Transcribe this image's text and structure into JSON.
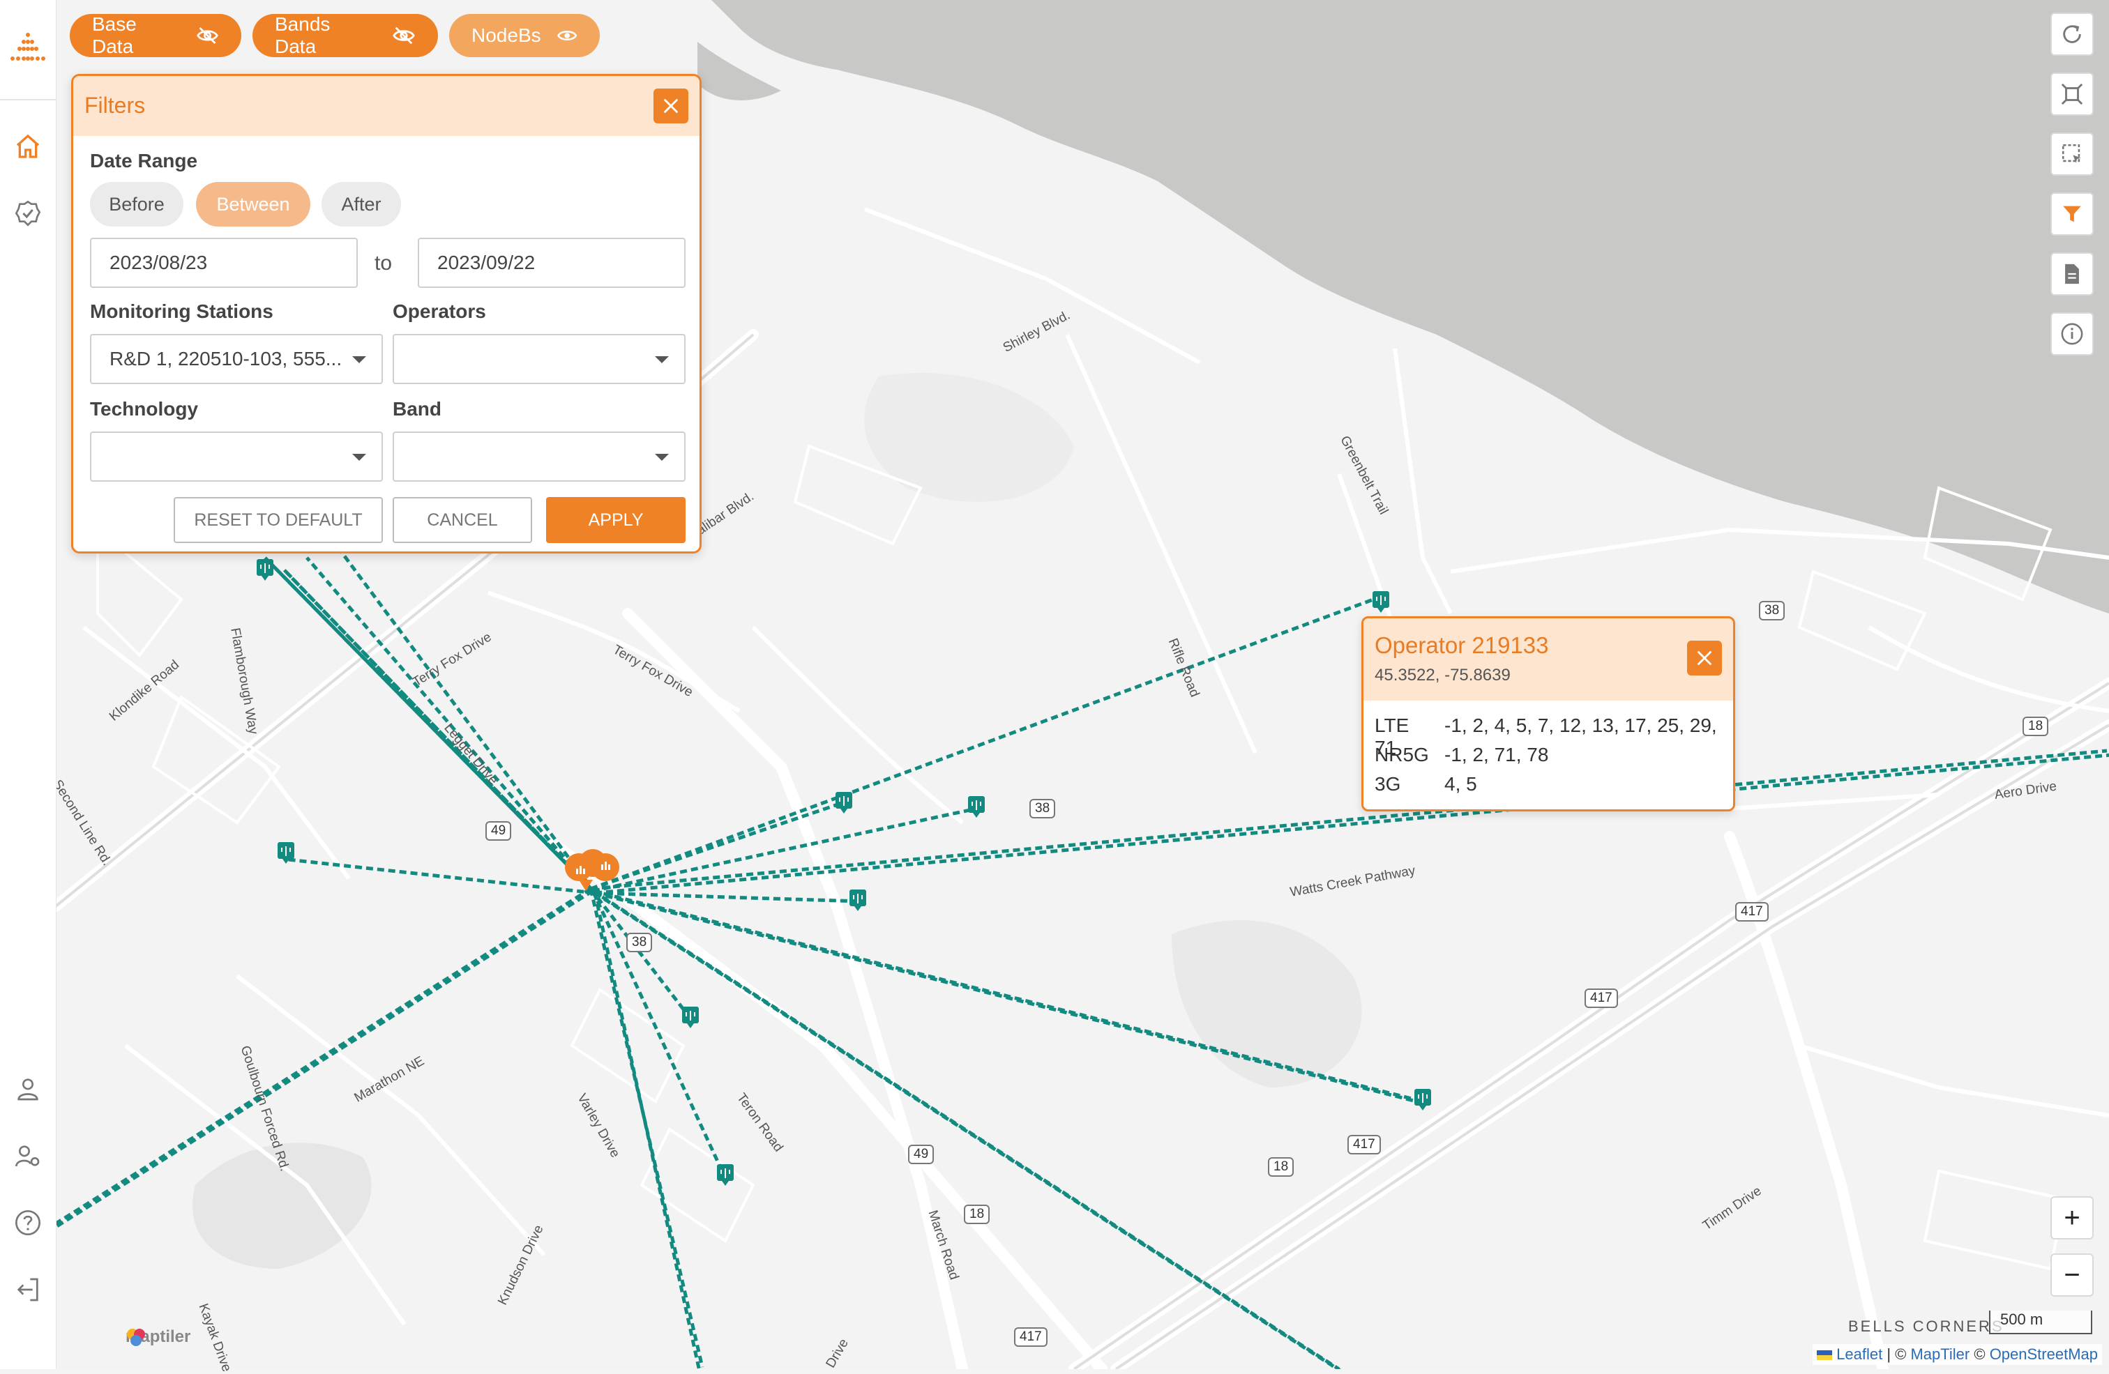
{
  "layers": {
    "base": {
      "label": "Base Data",
      "icon": "eye-off-icon"
    },
    "bands": {
      "label": "Bands Data",
      "icon": "eye-off-icon"
    },
    "nodebs": {
      "label": "NodeBs",
      "icon": "eye-icon"
    }
  },
  "filters": {
    "title": "Filters",
    "date_range_label": "Date Range",
    "modes": [
      "Before",
      "Between",
      "After"
    ],
    "active_mode": "Between",
    "date_from": "2023/08/23",
    "to_label": "to",
    "date_to": "2023/09/22",
    "monitoring_label": "Monitoring Stations",
    "monitoring_value": "R&D 1, 220510-103, 555...",
    "operators_label": "Operators",
    "operators_value": "",
    "technology_label": "Technology",
    "technology_value": "",
    "band_label": "Band",
    "band_value": "",
    "reset_label": "RESET TO DEFAULT",
    "cancel_label": "CANCEL",
    "apply_label": "APPLY"
  },
  "popup": {
    "title": "Operator 219133",
    "coords": "45.3522, -75.8639",
    "rows": [
      {
        "tech": "LTE",
        "bands": "-1, 2, 4, 5, 7, 12, 13, 17, 25, 29, 71"
      },
      {
        "tech": "NR5G",
        "bands": "-1, 2, 71, 78"
      },
      {
        "tech": "3G",
        "bands": "4, 5"
      }
    ]
  },
  "map": {
    "road_labels": [
      "Shirley Blvd.",
      "Greenbelt Trail",
      "Terry Fox Drive",
      "Terry Fox Drive",
      "Klondike Road",
      "Flamborough Way",
      "Legget Drive",
      "Rifle Road",
      "Watts Creek Pathway",
      "Aero Drive",
      "Marathon NE",
      "Goulbourn Forced Rd.",
      "Second Line Rd.",
      "Teron Road",
      "Varley Drive",
      "March Road",
      "Knudson Drive",
      "Kayak Drive",
      "Timm Drive",
      "Drive",
      "Calibar Blvd.",
      "BELLS CORNERS"
    ],
    "shields": [
      "38",
      "38",
      "18",
      "49",
      "38",
      "417",
      "417",
      "417",
      "49",
      "18",
      "18",
      "417"
    ],
    "scale": "500 m",
    "attribution": {
      "leaflet": "Leaflet",
      "maptiler": "MapTiler",
      "osm": "OpenStreetMap",
      "sep1": " | © ",
      "sep2": " © "
    },
    "maptiler_logo": "maptiler",
    "colors": {
      "accent": "#ef8126",
      "link_line": "#138a80",
      "water": "#c8c8c6"
    }
  },
  "sidebar": {
    "items": [
      "home-icon",
      "verified-badge-icon",
      "user-icon",
      "user-settings-icon",
      "help-icon",
      "logout-icon"
    ]
  },
  "tools": [
    "refresh-icon",
    "fit-bounds-icon",
    "select-area-icon",
    "filter-icon",
    "document-icon",
    "info-icon"
  ],
  "zoom": {
    "in": "+",
    "out": "−"
  }
}
